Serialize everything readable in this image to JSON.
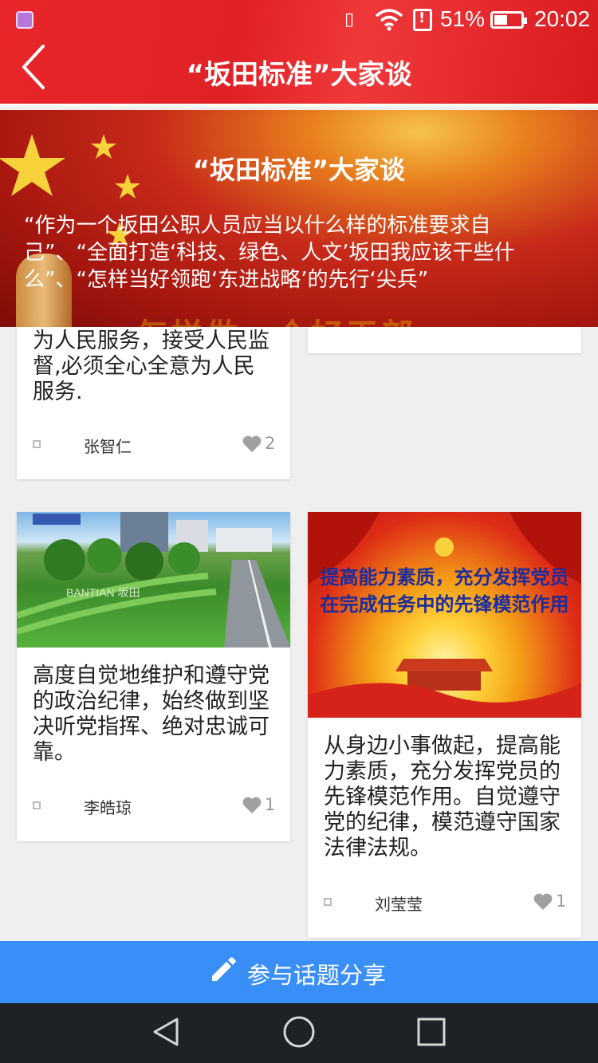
{
  "status_bar": {
    "battery_percent": "51%",
    "time": "20:02"
  },
  "nav": {
    "title": "“坂田标准”大家谈"
  },
  "banner": {
    "title": "“坂田标准”大家谈",
    "description": "“作为一个坂田公职人员应当以什么样的标准要求自己”、“全面打造‘科技、绿色、人文’坂田我应该干些什么”、“怎样当好领跑‘东进战略’的先行‘尖兵”",
    "watermark": "怎样做一个好干部"
  },
  "cards": [
    {
      "text": "为人民服务，接受人民监督,必须全心全意为人民服务.",
      "author": "张智仁",
      "likes": "2"
    },
    {
      "text": "高度自觉地维护和遵守党的政治纪律，始终做到坚决听党指挥、绝对忠诚可靠。",
      "author": "李皓琼",
      "likes": "1",
      "image_text": "BANTIAN 坂田"
    },
    {
      "text": "从身边小事做起，提高能力素质，充分发挥党员的先锋模范作用。自觉遵守党的纪律，模范遵守国家法律法规。",
      "author": "刘莹莹",
      "likes": "1",
      "image_caption_1": "提高能力素质，充分发挥党员",
      "image_caption_2": "在完成任务中的先锋模范作用"
    }
  ],
  "action_bar": {
    "label": "参与话题分享"
  },
  "colors": {
    "brand_red": "#e8262b",
    "action_blue": "#3a8ef7"
  }
}
